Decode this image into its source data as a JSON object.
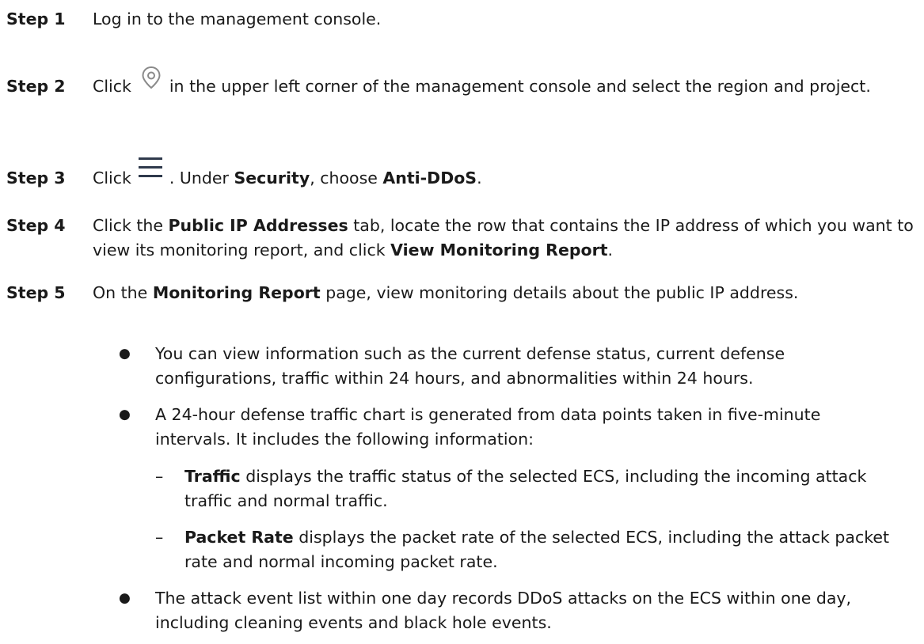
{
  "steps": [
    {
      "label": "Step 1",
      "text": "Log in to the management console."
    },
    {
      "label": "Step 2",
      "text_before": "Click",
      "icon": "location-pin-icon",
      "text_after": "in the upper left corner of the management console and select the region and project."
    },
    {
      "label": "Step 3",
      "text_before": "Click",
      "icon": "hamburger-menu-icon",
      "text_mid1": ". Under ",
      "bold1": "Security",
      "text_mid2": ", choose ",
      "bold2": "Anti-DDoS",
      "text_end": "."
    },
    {
      "label": "Step 4",
      "t1": "Click the ",
      "b1": "Public IP Addresses",
      "t2": " tab, locate the row that contains the IP address of which you want to view its monitoring report, and click ",
      "b2": "View Monitoring Report",
      "t3": "."
    },
    {
      "label": "Step 5",
      "t1": "On the ",
      "b1": "Monitoring Report",
      "t2": " page, view monitoring details about the public IP address."
    }
  ],
  "bullets": [
    {
      "mark": "●",
      "text": "You can view information such as the current defense status, current defense configurations, traffic within 24 hours, and abnormalities within 24 hours."
    },
    {
      "mark": "●",
      "text": "A 24-hour defense traffic chart is generated from data points taken in five-minute intervals. It includes the following information:"
    },
    {
      "mark": "●",
      "text": "The attack event list within one day records DDoS attacks on the ECS within one day, including cleaning events and black hole events."
    }
  ],
  "subbullets": [
    {
      "mark": "–",
      "bold": "Traffic",
      "text": " displays the traffic status of the selected ECS, including the incoming attack traffic and normal traffic."
    },
    {
      "mark": "–",
      "bold": "Packet Rate",
      "text": " displays the packet rate of the selected ECS, including the attack packet rate and normal incoming packet rate."
    }
  ]
}
